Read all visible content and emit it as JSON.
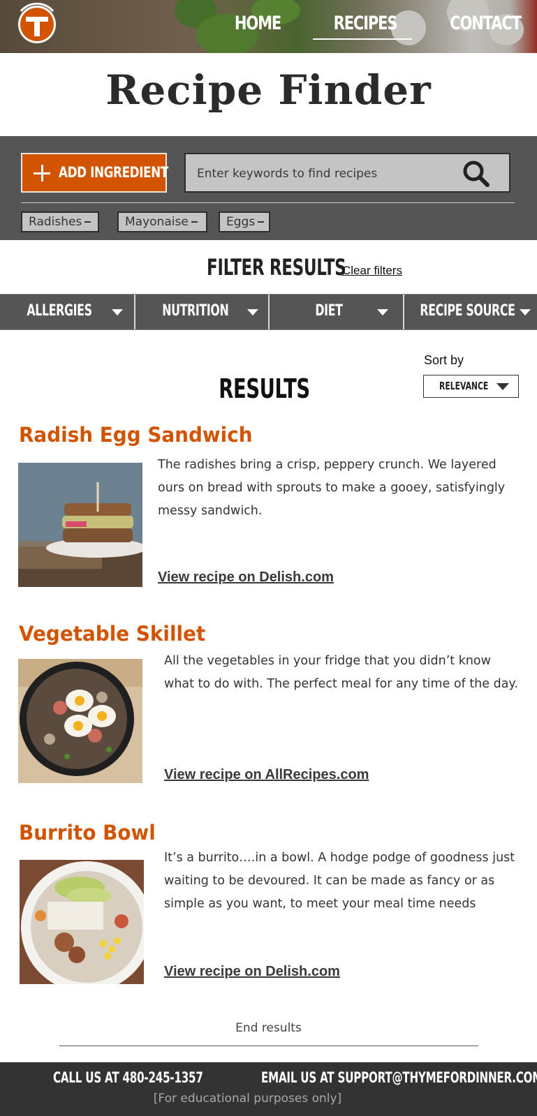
{
  "nav": {
    "home": "HOME",
    "recipes": "RECIPES",
    "contact": "CONTACT"
  },
  "page": {
    "title": "Recipe Finder"
  },
  "search": {
    "add_button_label": "ADD INGREDIENT",
    "placeholder": "Enter keywords to find recipes",
    "chips": [
      "Radishes",
      "Mayonaise",
      "Eggs"
    ]
  },
  "filters": {
    "title": "FILTER RESULTS",
    "clear_label": "Clear filters",
    "items": [
      "ALLERGIES",
      "NUTRITION",
      "DIET",
      "RECIPE SOURCE"
    ]
  },
  "results": {
    "title": "RESULTS",
    "sort_label": "Sort by",
    "sort_value": "RELEVANCE",
    "items": [
      {
        "title": "Radish Egg Sandwich",
        "description": "The radishes bring a crisp, peppery crunch. We layered ours on bread with sprouts to make a gooey, satisfyingly messy sandwich.",
        "link": "View recipe on Delish.com"
      },
      {
        "title": "Vegetable Skillet",
        "description": "All the vegetables in your fridge that you didn’t know what to do with. The perfect meal for any time of the day.",
        "link": "View recipe on AllRecipes.com"
      },
      {
        "title": "Burrito Bowl",
        "description": "It’s a burrito….in a bowl. A hodge podge of goodness just waiting to be devoured. It can be made as fancy or as simple as you want, to meet your meal time needs",
        "link": "View recipe on Delish.com"
      }
    ],
    "end_label": "End results"
  },
  "footer": {
    "call": "CALL US AT 480-245-1357",
    "email": "EMAIL US AT SUPPORT@THYMEFORDINNER.COM",
    "note": "[For educational purposes only]"
  },
  "colors": {
    "accent": "#d35400",
    "panel": "#555555",
    "footer": "#333333"
  }
}
